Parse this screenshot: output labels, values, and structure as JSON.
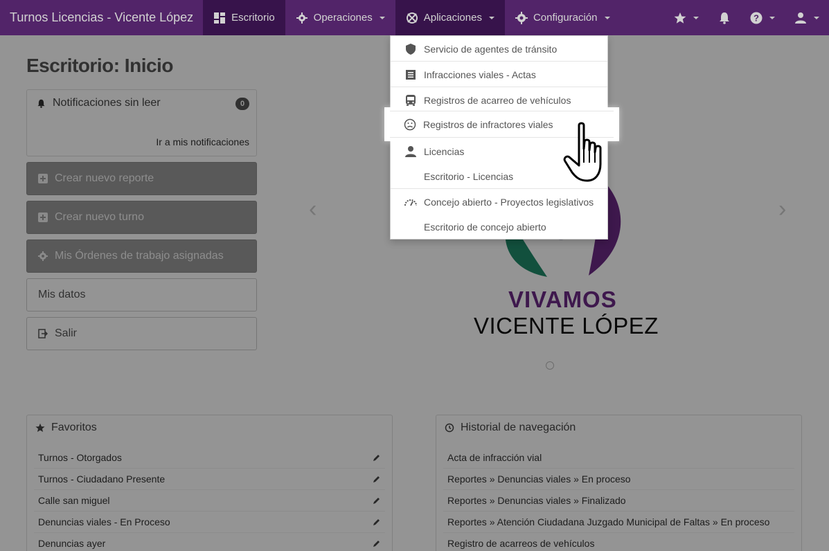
{
  "navbar": {
    "brand": "Turnos Licencias - Vicente López",
    "items": [
      {
        "label": "Escritorio",
        "icon": "dashboard-icon"
      },
      {
        "label": "Operaciones",
        "icon": "gear-cog-icon"
      },
      {
        "label": "Aplicaciones",
        "icon": "apps-icon"
      },
      {
        "label": "Configuración",
        "icon": "gear-icon"
      }
    ],
    "right_icons": [
      "star-icon",
      "bell-icon",
      "help-icon",
      "user-icon"
    ]
  },
  "page": {
    "title": "Escritorio: Inicio"
  },
  "notifications": {
    "title": "Notificaciones sin leer",
    "count": "0",
    "link": "Ir a mis notificaciones"
  },
  "actions": {
    "create_report": "Crear nuevo reporte",
    "create_turn": "Crear nuevo turno",
    "work_orders": "Mis Órdenes de trabajo asignadas",
    "my_data": "Mis datos",
    "logout": "Salir"
  },
  "carousel": {
    "logo_title": "VIVAMOS",
    "logo_subtitle": "VICENTE LÓPEZ"
  },
  "favorites": {
    "title": "Favoritos",
    "items": [
      "Turnos - Otorgados",
      "Turnos - Ciudadano Presente",
      "Calle san miguel",
      "Denuncias viales - En Proceso",
      "Denuncias ayer"
    ]
  },
  "history": {
    "title": "Historial de navegación",
    "items": [
      "Acta de infracción vial",
      "Reportes » Denuncias viales » En proceso",
      "Reportes » Denuncias viales » Finalizado",
      "Reportes » Atención Ciudadana Juzgado Municipal de Faltas » En proceso",
      "Registro de acarreos de vehículos"
    ]
  },
  "apps_menu": {
    "items": [
      {
        "label": "Servicio de agentes de tránsito",
        "icon": "shield-icon"
      },
      {
        "label": "Infracciones viales - Actas",
        "icon": "list-icon"
      },
      {
        "label": "Registros de acarreo de vehículos",
        "icon": "bus-icon"
      },
      {
        "label": "Registros de infractores viales",
        "icon": "sad-face-icon"
      },
      {
        "label": "Licencias",
        "icon": "person-icon"
      },
      {
        "label": "Escritorio - Licencias",
        "icon": ""
      },
      {
        "label": "Concejo abierto - Proyectos legislativos",
        "icon": "speedometer-icon"
      },
      {
        "label": "Escritorio de concejo abierto",
        "icon": ""
      }
    ]
  }
}
